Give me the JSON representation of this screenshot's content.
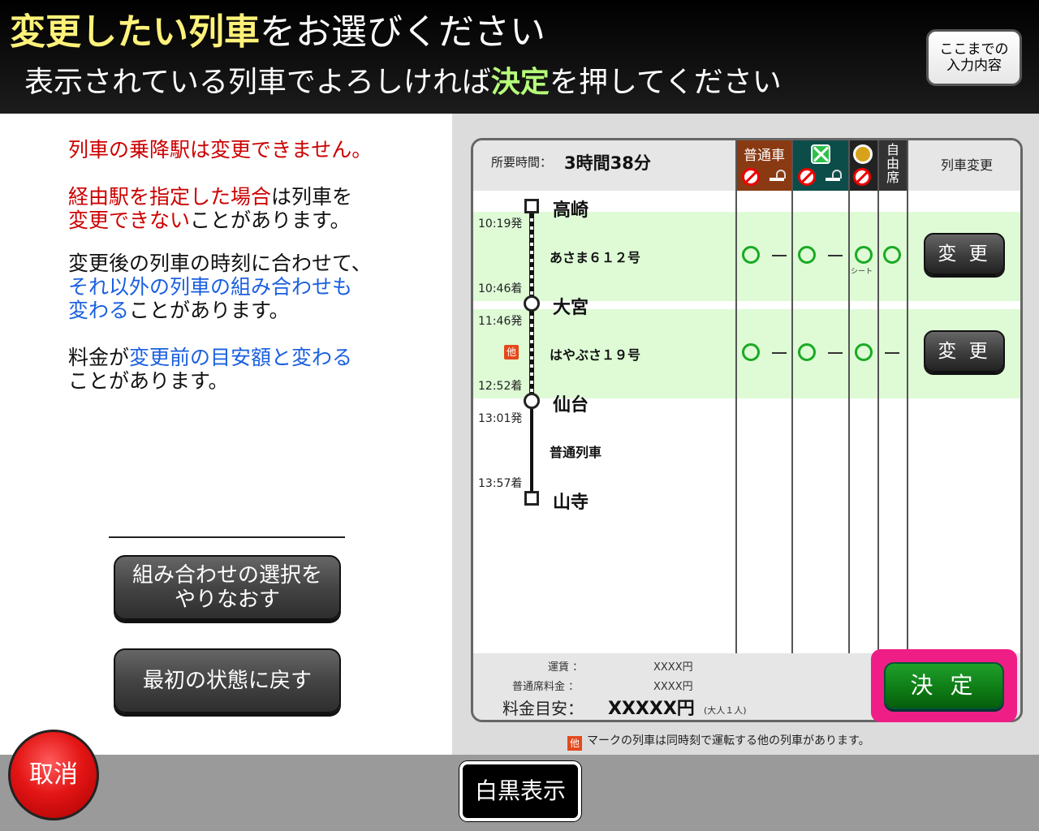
{
  "header": {
    "title_highlight": "変更したい列車",
    "title_rest": "をお選びください",
    "subtitle_pre": "表示されている列車でよろしければ",
    "subtitle_highlight": "決定",
    "subtitle_post": "を押してください",
    "summary_button_line1": "ここまでの",
    "summary_button_line2": "入力内容"
  },
  "notes": {
    "n1": "列車の乗降駅は変更できません。",
    "n2_red1": "経由駅を指定した場合",
    "n2_plain1": "は列車を",
    "n2_red2": "変更できない",
    "n2_plain2": "ことがあります。",
    "n3_plain1": "変更後の列車の時刻に合わせて、",
    "n3_blue1": "それ以外の列車の組み合わせも",
    "n3_blue2": "変わる",
    "n3_plain2": "ことがあります。",
    "n4_plain1": "料金が",
    "n4_blue": "変更前の目安額と変わる",
    "n4_plain2": "ことがあります。"
  },
  "left_buttons": {
    "reselect_line1": "組み合わせの選択を",
    "reselect_line2": "やりなおす",
    "reset": "最初の状態に戻す"
  },
  "table": {
    "time_label": "所要時間：",
    "time_value": "3時間38分",
    "headers": {
      "ordinary": "普通車",
      "free_line1": "自",
      "free_line2": "由",
      "free_line3": "席",
      "change": "列車変更"
    },
    "stations": [
      "高崎",
      "大宮",
      "仙台",
      "山寺"
    ],
    "segments": [
      {
        "dep": "10:19発",
        "arr": "10:46着",
        "train": "あさま６１２号",
        "ordinary_ns": "○",
        "ordinary_s": "－",
        "green_ns": "○",
        "green_s": "－",
        "gran": "○",
        "gran_sub": "シート",
        "free": "○",
        "change_label": "変 更",
        "other_badge": ""
      },
      {
        "dep": "11:46発",
        "arr": "12:52着",
        "train": "はやぶさ１９号",
        "ordinary_ns": "○",
        "ordinary_s": "－",
        "green_ns": "○",
        "green_s": "－",
        "gran": "○",
        "gran_sub": "",
        "free": "－",
        "change_label": "変 更",
        "other_badge": "他"
      },
      {
        "dep": "13:01発",
        "arr": "13:57着",
        "train": "普通列車"
      }
    ],
    "fare": {
      "fare_label": "運賃 ：",
      "fare_value": "XXXX円",
      "seat_label": "普通席料金 ：",
      "seat_value": "XXXX円",
      "total_label": "料金目安：",
      "total_value": "XXXXX円",
      "total_note": "(大人１人)"
    },
    "decide_label": "決 定"
  },
  "legend": {
    "badge": "他",
    "text": "マークの列車は同時刻で運転する他の列車があります。"
  },
  "footer": {
    "cancel": "取消",
    "bw_display": "白黒表示"
  },
  "colors": {
    "title_highlight": "#fff27a",
    "subtitle_highlight": "#b6ff7a",
    "warning_red": "#cc0000",
    "info_blue": "#1a5fe0",
    "available_green": "#1aaa24",
    "segment_bg": "#defbd6",
    "decide_frame": "#ee1e86"
  }
}
